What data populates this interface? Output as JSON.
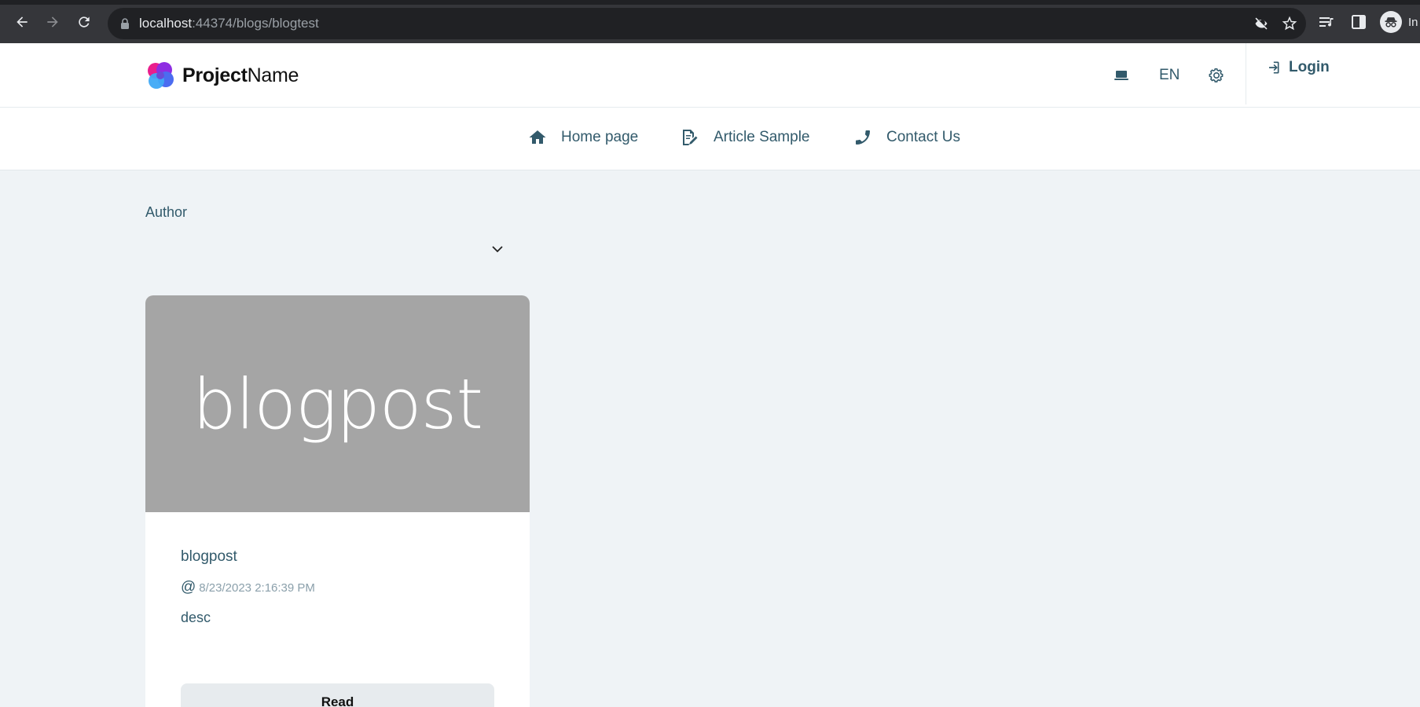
{
  "browser": {
    "url_host": "localhost",
    "url_rest": ":44374/blogs/blogtest",
    "profile_text": "In"
  },
  "header": {
    "brand_bold": "Project",
    "brand_light": "Name",
    "language": "EN",
    "login_label": "Login"
  },
  "nav": {
    "items": [
      {
        "label": "Home page",
        "icon": "home-icon"
      },
      {
        "label": "Article Sample",
        "icon": "article-edit-icon"
      },
      {
        "label": "Contact Us",
        "icon": "phone-icon"
      }
    ]
  },
  "filter": {
    "author_label": "Author",
    "author_value": ""
  },
  "posts": [
    {
      "image_text": "blogpost",
      "title": "blogpost",
      "at_symbol": "@",
      "date": "8/23/2023 2:16:39 PM",
      "description": "desc",
      "read_label": "Read"
    }
  ],
  "colors": {
    "text_primary": "#325a6b",
    "page_bg": "#eff3f6",
    "image_placeholder": "#a5a5a5"
  }
}
